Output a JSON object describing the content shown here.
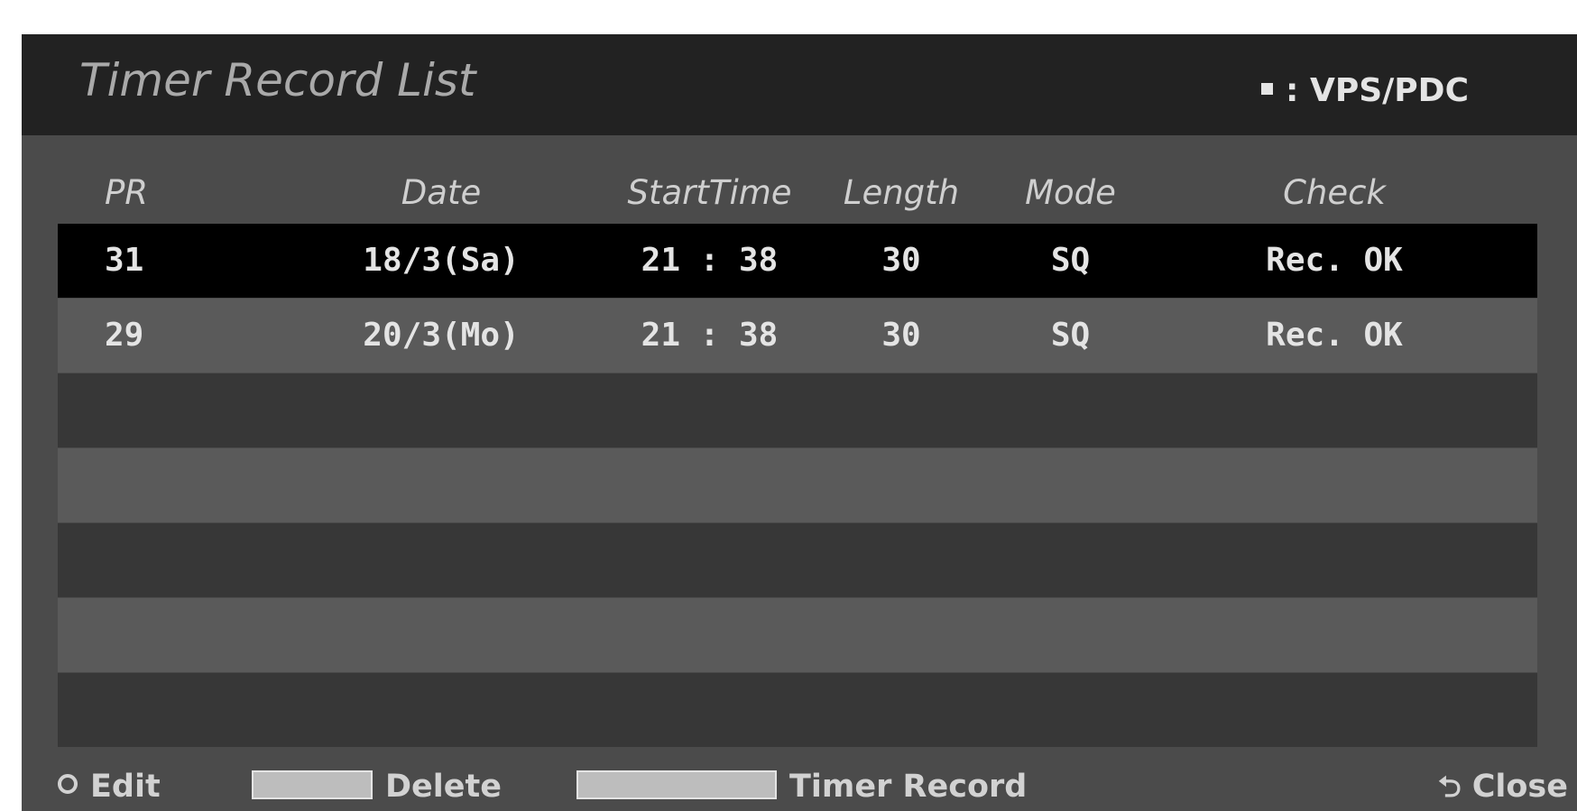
{
  "title": "Timer Record List",
  "legend": {
    "icon": "vps-pdc-marker",
    "text": ": VPS/PDC"
  },
  "columns": [
    "PR",
    "Date",
    "StartTime",
    "Length",
    "Mode",
    "Check"
  ],
  "rows": [
    {
      "pr": "31",
      "date": "18/3(Sa)",
      "start": "21 : 38",
      "length": "30",
      "mode": "SQ",
      "check": "Rec. OK"
    },
    {
      "pr": "29",
      "date": "20/3(Mo)",
      "start": "21 : 38",
      "length": "30",
      "mode": "SQ",
      "check": "Rec. OK"
    }
  ],
  "footer": {
    "edit_label": "Edit",
    "delete_label": "Delete",
    "timer_record_label": "Timer Record",
    "close_label": "Close"
  },
  "colors": {
    "background": "#4b4b4b",
    "title_bar": "#222222",
    "selected_row": "#000000",
    "row_light": "#5a5a5a",
    "row_dark": "#373737",
    "text": "#e4e4e4"
  }
}
